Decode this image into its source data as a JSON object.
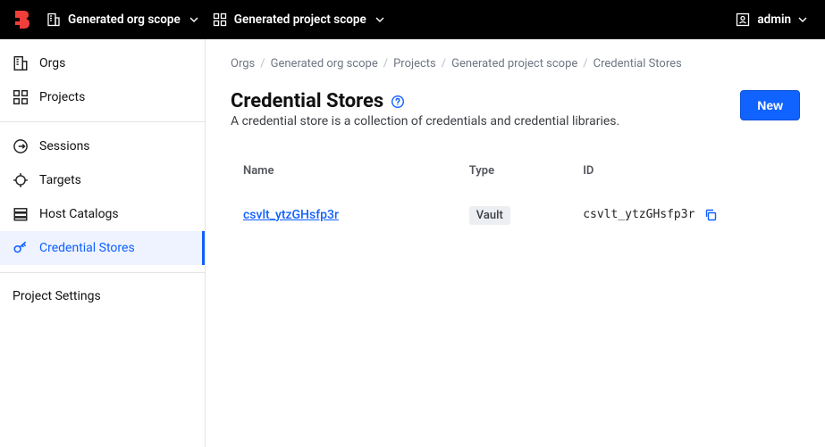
{
  "topbar": {
    "org_scope_label": "Generated org scope",
    "project_scope_label": "Generated project scope",
    "user_label": "admin"
  },
  "sidebar": {
    "items": [
      {
        "label": "Orgs"
      },
      {
        "label": "Projects"
      },
      {
        "label": "Sessions"
      },
      {
        "label": "Targets"
      },
      {
        "label": "Host Catalogs"
      },
      {
        "label": "Credential Stores"
      },
      {
        "label": "Project Settings"
      }
    ]
  },
  "breadcrumbs": {
    "items": [
      "Orgs",
      "Generated org scope",
      "Projects",
      "Generated project scope",
      "Credential Stores"
    ]
  },
  "page": {
    "title": "Credential Stores",
    "subtitle": "A credential store is a collection of credentials and credential libraries.",
    "new_button": "New"
  },
  "table": {
    "headers": {
      "name": "Name",
      "type": "Type",
      "id": "ID"
    },
    "rows": [
      {
        "name": "csvlt_ytzGHsfp3r",
        "type": "Vault",
        "id": "csvlt_ytzGHsfp3r"
      }
    ]
  }
}
